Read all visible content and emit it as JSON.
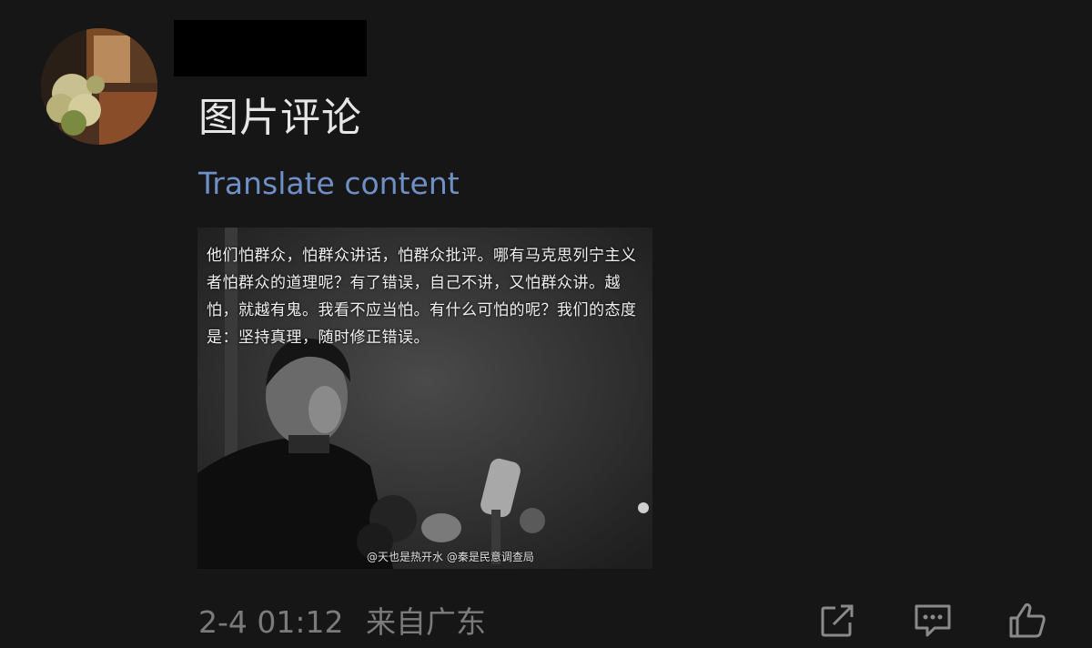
{
  "comment": {
    "text": "图片评论",
    "translate_label": "Translate content"
  },
  "image": {
    "quote": "他们怕群众，怕群众讲话，怕群众批评。哪有马克思列宁主义者怕群众的道理呢？有了错误，自己不讲，又怕群众讲。越怕，就越有鬼。我看不应当怕。有什么可怕的呢？我们的态度是：坚持真理，随时修正错误。",
    "watermark": "@天也是热开水 @秦是民意调查局"
  },
  "meta": {
    "timestamp": "2-4 01:12",
    "location": "来自广东"
  },
  "actions": {
    "share_icon": "share-icon",
    "comment_icon": "comment-icon",
    "like_icon": "thumbs-up-icon"
  },
  "colors": {
    "background": "#161616",
    "link": "#6f8fc6",
    "meta_text": "#7b7b7b"
  }
}
